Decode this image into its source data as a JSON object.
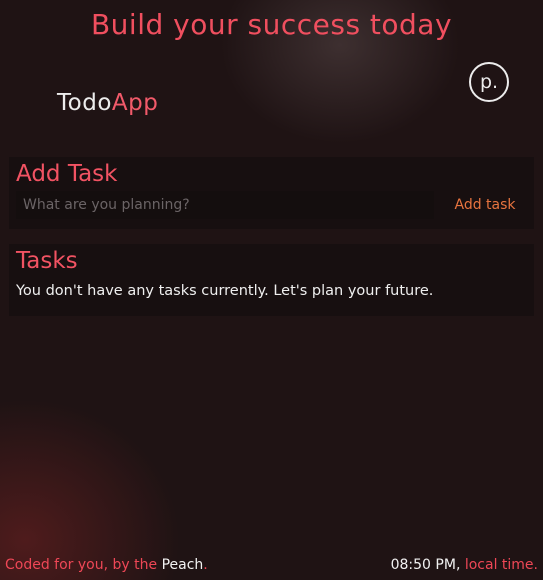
{
  "header": {
    "headline": "Build your success today"
  },
  "brand": {
    "name_part1": "Todo",
    "name_part2": "App",
    "logo_letter": "p.",
    "logo_icon": "peach-logo-icon"
  },
  "add_task": {
    "title": "Add Task",
    "input_value": "",
    "input_placeholder": "What are you planning?",
    "button_label": "Add task"
  },
  "tasks": {
    "title": "Tasks",
    "empty_message": "You don't have any tasks currently. Let's plan your future.",
    "items": []
  },
  "footer": {
    "credit_prefix": "Coded for you, by the ",
    "credit_name": "Peach",
    "credit_suffix": ".",
    "time": "08:50 PM",
    "time_separator": ", ",
    "time_label": "local time",
    "time_suffix": "."
  },
  "colors": {
    "background": "#1f1314",
    "accent": "#f04f5f",
    "button_accent": "#e8743f",
    "text": "#ececec"
  }
}
